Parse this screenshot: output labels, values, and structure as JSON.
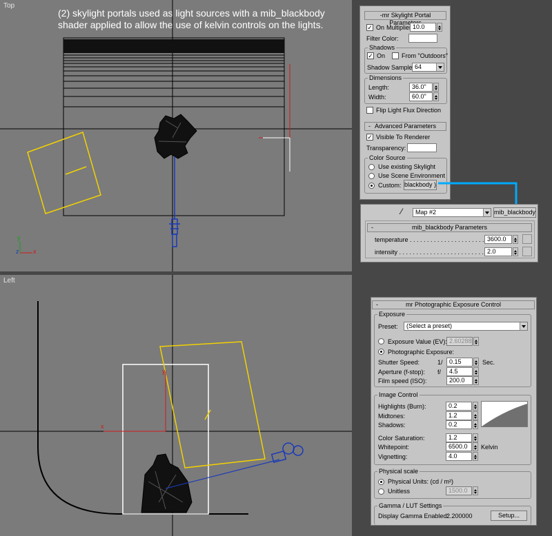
{
  "viewports": {
    "top": {
      "label": "Top"
    },
    "left": {
      "label": "Left"
    },
    "caption": "(2) skylight portals used as light sources with a mib_blackbody shader applied to allow the use of kelvin controls on the lights.",
    "axis_x": "x",
    "axis_y": "y",
    "axis_z": "z"
  },
  "portal": {
    "title": "mr Skylight Portal Parameters",
    "title_prefix": "-",
    "on_label": "On",
    "on_checked": true,
    "multiplier_label": "Multiplier:",
    "multiplier_value": "10.0",
    "filter_color_label": "Filter Color:",
    "filter_color": "#ffffff",
    "shadows_group": "Shadows",
    "shadows_on_label": "On",
    "shadows_on_checked": true,
    "from_outdoors_label": "From \"Outdoors\"",
    "from_outdoors_checked": false,
    "shadow_samples_label": "Shadow Samples:",
    "shadow_samples_value": "64",
    "dimensions_group": "Dimensions",
    "length_label": "Length:",
    "length_value": "36.0\"",
    "width_label": "Width:",
    "width_value": "60.0\"",
    "flip_label": "Flip Light Flux Direction",
    "flip_checked": false
  },
  "advanced": {
    "title": "Advanced Parameters",
    "title_prefix": "-",
    "visible_label": "Visible To Renderer",
    "visible_checked": true,
    "transparency_label": "Transparency:",
    "transparency_color": "#ffffff",
    "color_source_group": "Color Source",
    "options": [
      "Use existing Skylight",
      "Use Scene Environment",
      "Custom:"
    ],
    "selected_option": 2,
    "custom_map_label": "blackbody )"
  },
  "map": {
    "picker_icon": "eyedropper-icon",
    "map_name": "Map #2",
    "map_type": "mib_blackbody",
    "params_title": "mib_blackbody Parameters",
    "params_prefix": "-",
    "temperature_label": "temperature",
    "temperature_value": "3600.0",
    "intensity_label": "intensity",
    "intensity_value": "2.0"
  },
  "connector_color": "#00aaff",
  "exposure": {
    "title": "mr Photographic Exposure Control",
    "title_prefix": "-",
    "exposure_group": "Exposure",
    "preset_label": "Preset:",
    "preset_value": "(Select a preset)",
    "ev_label": "Exposure Value (EV):",
    "ev_value": "2.60288",
    "ev_selected": false,
    "photo_label": "Photographic Exposure:",
    "photo_selected": true,
    "shutter_label": "Shutter Speed:",
    "shutter_prefix": "1/",
    "shutter_value": "0.15",
    "shutter_unit": "Sec.",
    "aperture_label": "Aperture (f-stop):",
    "aperture_prefix": "f/",
    "aperture_value": "4.5",
    "film_label": "Film speed (ISO):",
    "film_value": "200.0",
    "image_group": "Image Control",
    "highlights_label": "Highlights (Burn):",
    "highlights_value": "0.2",
    "midtones_label": "Midtones:",
    "midtones_value": "1.2",
    "shadows_label": "Shadows:",
    "shadows_value": "0.2",
    "saturation_label": "Color Saturation:",
    "saturation_value": "1.2",
    "whitepoint_label": "Whitepoint:",
    "whitepoint_value": "6500.0",
    "whitepoint_unit": "Kelvin",
    "vignetting_label": "Vignetting:",
    "vignetting_value": "4.0",
    "physical_group": "Physical scale",
    "physical_units_label": "Physical Units: (cd / m²)",
    "physical_units_selected": true,
    "unitless_label": "Unitless",
    "unitless_value": "1500.0",
    "unitless_selected": false,
    "gamma_group": "Gamma / LUT Settings",
    "gamma_label": "Display Gamma Enabled:",
    "gamma_value": "2.200000",
    "setup_label": "Setup..."
  }
}
